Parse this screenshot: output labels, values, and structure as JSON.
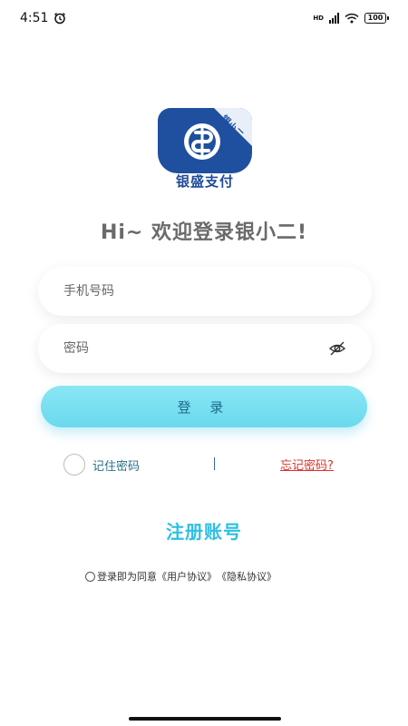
{
  "status_bar": {
    "time": "4:51",
    "network_label": "HD",
    "battery_level": "100"
  },
  "logo": {
    "text": "银盛支付",
    "ribbon_text": "银小二"
  },
  "welcome": {
    "text": "Hi~ 欢迎登录银小二!"
  },
  "form": {
    "phone_placeholder": "手机号码",
    "phone_value": "",
    "password_placeholder": "密码",
    "password_value": "",
    "login_label": "登 录",
    "remember_label": "记住密码",
    "remember_checked": false,
    "divider_text": "|",
    "forgot_label": "忘记密码?"
  },
  "register": {
    "label": "注册账号"
  },
  "agreement": {
    "prefix": "登录即为同意",
    "user_agreement": "《用户协议》",
    "privacy_agreement": "《隐私协议》"
  },
  "colors": {
    "accent": "#2ec0e0",
    "button": "#7ddff0",
    "forgot": "#d9342b",
    "brand": "#1f4f9f"
  }
}
